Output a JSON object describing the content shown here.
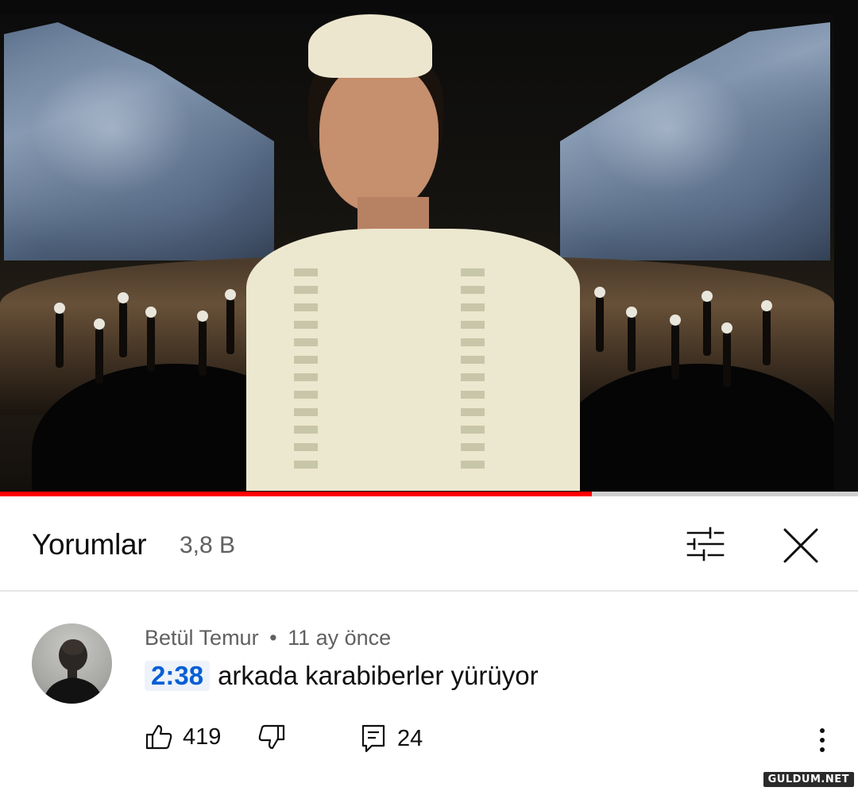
{
  "video": {
    "progress_fraction": 0.69,
    "accent_color": "#ff0000"
  },
  "header": {
    "title": "Yorumlar",
    "count": "3,8 B",
    "filter_icon": "sort-filter-icon",
    "close_icon": "close-icon"
  },
  "comment": {
    "author": "Betül Temur",
    "separator": "•",
    "time_ago": "11 ay önce",
    "timestamp_link": "2:38",
    "text": "arkada karabiberler yürüyor",
    "likes": "419",
    "replies": "24",
    "timestamp_color": "#065fd4"
  },
  "watermark": "GULDUM.NET"
}
